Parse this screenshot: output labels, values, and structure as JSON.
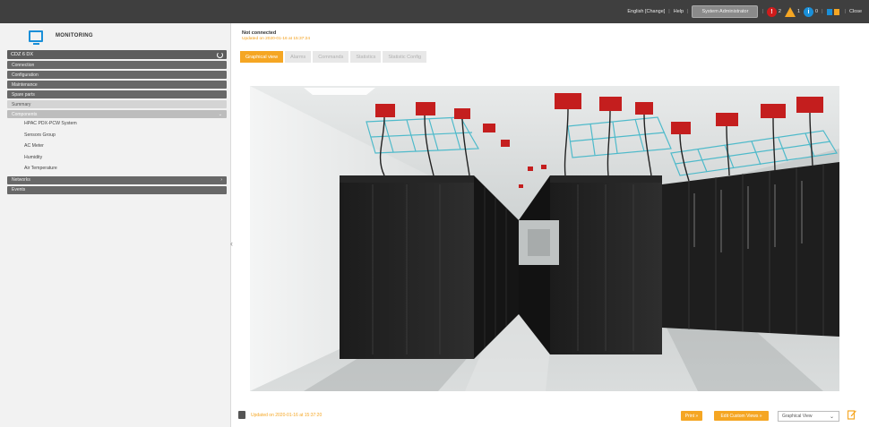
{
  "topbar": {
    "language": "English [Change]",
    "help": "Help",
    "user_button": "System Administrator",
    "alarm_critical_count": "2",
    "alarm_warning_count": "1",
    "alarm_info_count": "0",
    "close": "Close"
  },
  "sidebar": {
    "app_title": "MONITORING",
    "device": "CDZ 6 DX",
    "items": [
      {
        "label": "Connection",
        "style": "dark"
      },
      {
        "label": "Configuration",
        "style": "dark"
      },
      {
        "label": "Maintenance",
        "style": "dark"
      },
      {
        "label": "Spare parts",
        "style": "dark"
      },
      {
        "label": "Summary",
        "style": "light"
      },
      {
        "label": "Components",
        "style": "mid"
      }
    ],
    "components": [
      "HPAC PDX-PCW System",
      "Sensors Group",
      "AC Meter",
      "Humidity",
      "Air Temperature"
    ],
    "networks": "Networks",
    "events": "Events"
  },
  "status": {
    "connection": "Not connected",
    "updated": "Updated on 2020-01-16 at 15:37:24"
  },
  "tabs": [
    "Graphical view",
    "Alarms",
    "Commands",
    "Statistics",
    "Statistic Config"
  ],
  "bottom": {
    "updated": "Updated on 2020-01-16 at 15:37:20",
    "print": "Print »",
    "edit": "Edit Custom Views »",
    "view_select": "Graphical View"
  },
  "colors": {
    "accent": "#f5a623",
    "topbar": "#3f3f3f",
    "sidebar_dark": "#686868",
    "critical": "#d01c1c",
    "info": "#1a8fd8"
  }
}
